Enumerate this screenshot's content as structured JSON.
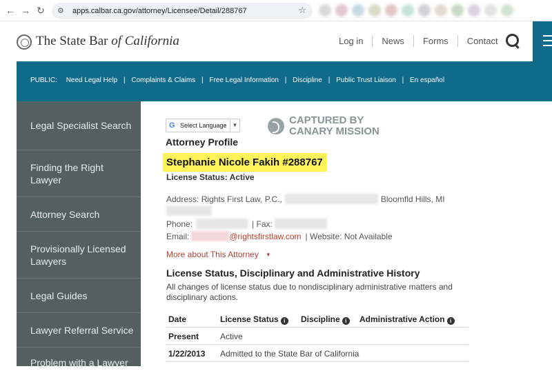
{
  "browser": {
    "url": "apps.calbar.ca.gov/attorney/Licensee/Detail/288767"
  },
  "header": {
    "brand_prefix": "The State Bar ",
    "brand_of": "of ",
    "brand_california": "California",
    "nav": [
      "Log in",
      "News",
      "Forms",
      "Contact"
    ]
  },
  "banner": {
    "public_label": "PUBLIC:",
    "links": [
      "Need Legal Help",
      "Complaints & Claims",
      "Free Legal Information",
      "Discipline",
      "Public Trust Liaison",
      "En español"
    ]
  },
  "sidebar": {
    "items": [
      "Legal Specialist Search",
      "Finding the Right Lawyer",
      "Attorney Search",
      "Provisionally Licensed Lawyers",
      "Legal Guides",
      "Lawyer Referral Service",
      "Problem with a Lawyer"
    ]
  },
  "translate": {
    "label": "Select Language"
  },
  "watermark": {
    "line1": "CAPTURED BY",
    "line2": "CANARY MISSION"
  },
  "profile": {
    "heading": "Attorney Profile",
    "name": "Stephanie Nicole Fakih #288767",
    "license_status": "License Status: Active",
    "address_label": "Address: Rights First Law, P.C.,",
    "address_city": "Bloomfld Hills, MI",
    "phone_label": "Phone:",
    "fax_label": "| Fax:",
    "email_label": "Email:",
    "email_domain": "@rightsfirstlaw.com",
    "website": "|  Website: Not Available",
    "more_link": "More about This Attorney"
  },
  "history": {
    "heading": "License Status, Disciplinary and Administrative History",
    "description": "All changes of license status due to nondisciplinary administrative matters and disciplinary actions.",
    "columns": [
      "Date",
      "License Status",
      "Discipline",
      "Administrative Action"
    ],
    "rows": [
      [
        "Present",
        "Active",
        "",
        ""
      ],
      [
        "1/22/2013",
        "Admitted to the State Bar of California",
        "",
        ""
      ]
    ]
  }
}
